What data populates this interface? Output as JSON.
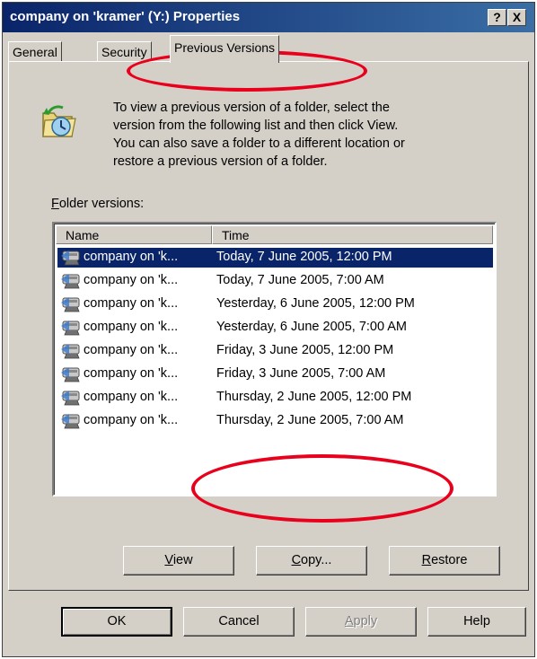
{
  "window": {
    "title": "company on 'kramer' (Y:) Properties",
    "help_button": "?",
    "close_button": "X"
  },
  "tabs": [
    {
      "label": "General"
    },
    {
      "label": "Security"
    },
    {
      "label": "Previous Versions",
      "active": true
    }
  ],
  "panel": {
    "description_lines": [
      "To view a previous version of a folder, select the",
      "version from the following list and then click View.",
      "You can also save a folder to a different location or",
      "restore a previous version of a folder."
    ],
    "versions_label_access": "F",
    "versions_label_rest": "older versions:",
    "columns": {
      "name": "Name",
      "time": "Time"
    },
    "rows": [
      {
        "name": "company on 'k...",
        "time": "Today, 7 June 2005, 12:00 PM",
        "selected": true
      },
      {
        "name": "company on 'k...",
        "time": "Today, 7 June 2005, 7:00 AM"
      },
      {
        "name": "company on 'k...",
        "time": "Yesterday, 6 June 2005, 12:00 PM"
      },
      {
        "name": "company on 'k...",
        "time": "Yesterday, 6 June 2005, 7:00 AM"
      },
      {
        "name": "company on 'k...",
        "time": "Friday, 3 June 2005, 12:00 PM"
      },
      {
        "name": "company on 'k...",
        "time": "Friday, 3 June 2005, 7:00 AM"
      },
      {
        "name": "company on 'k...",
        "time": "Thursday, 2 June 2005, 12:00 PM"
      },
      {
        "name": "company on 'k...",
        "time": "Thursday, 2 June 2005, 7:00 AM"
      }
    ],
    "buttons": {
      "view_access": "V",
      "view_rest": "iew",
      "copy_access": "C",
      "copy_rest": "opy...",
      "restore_access": "R",
      "restore_rest": "estore"
    }
  },
  "footer": {
    "ok": "OK",
    "cancel": "Cancel",
    "apply_access": "A",
    "apply_rest": "pply",
    "help": "Help"
  },
  "colors": {
    "annotation": "#e8001c",
    "selection": "#0a246a",
    "titlebar": "#0a246a"
  }
}
